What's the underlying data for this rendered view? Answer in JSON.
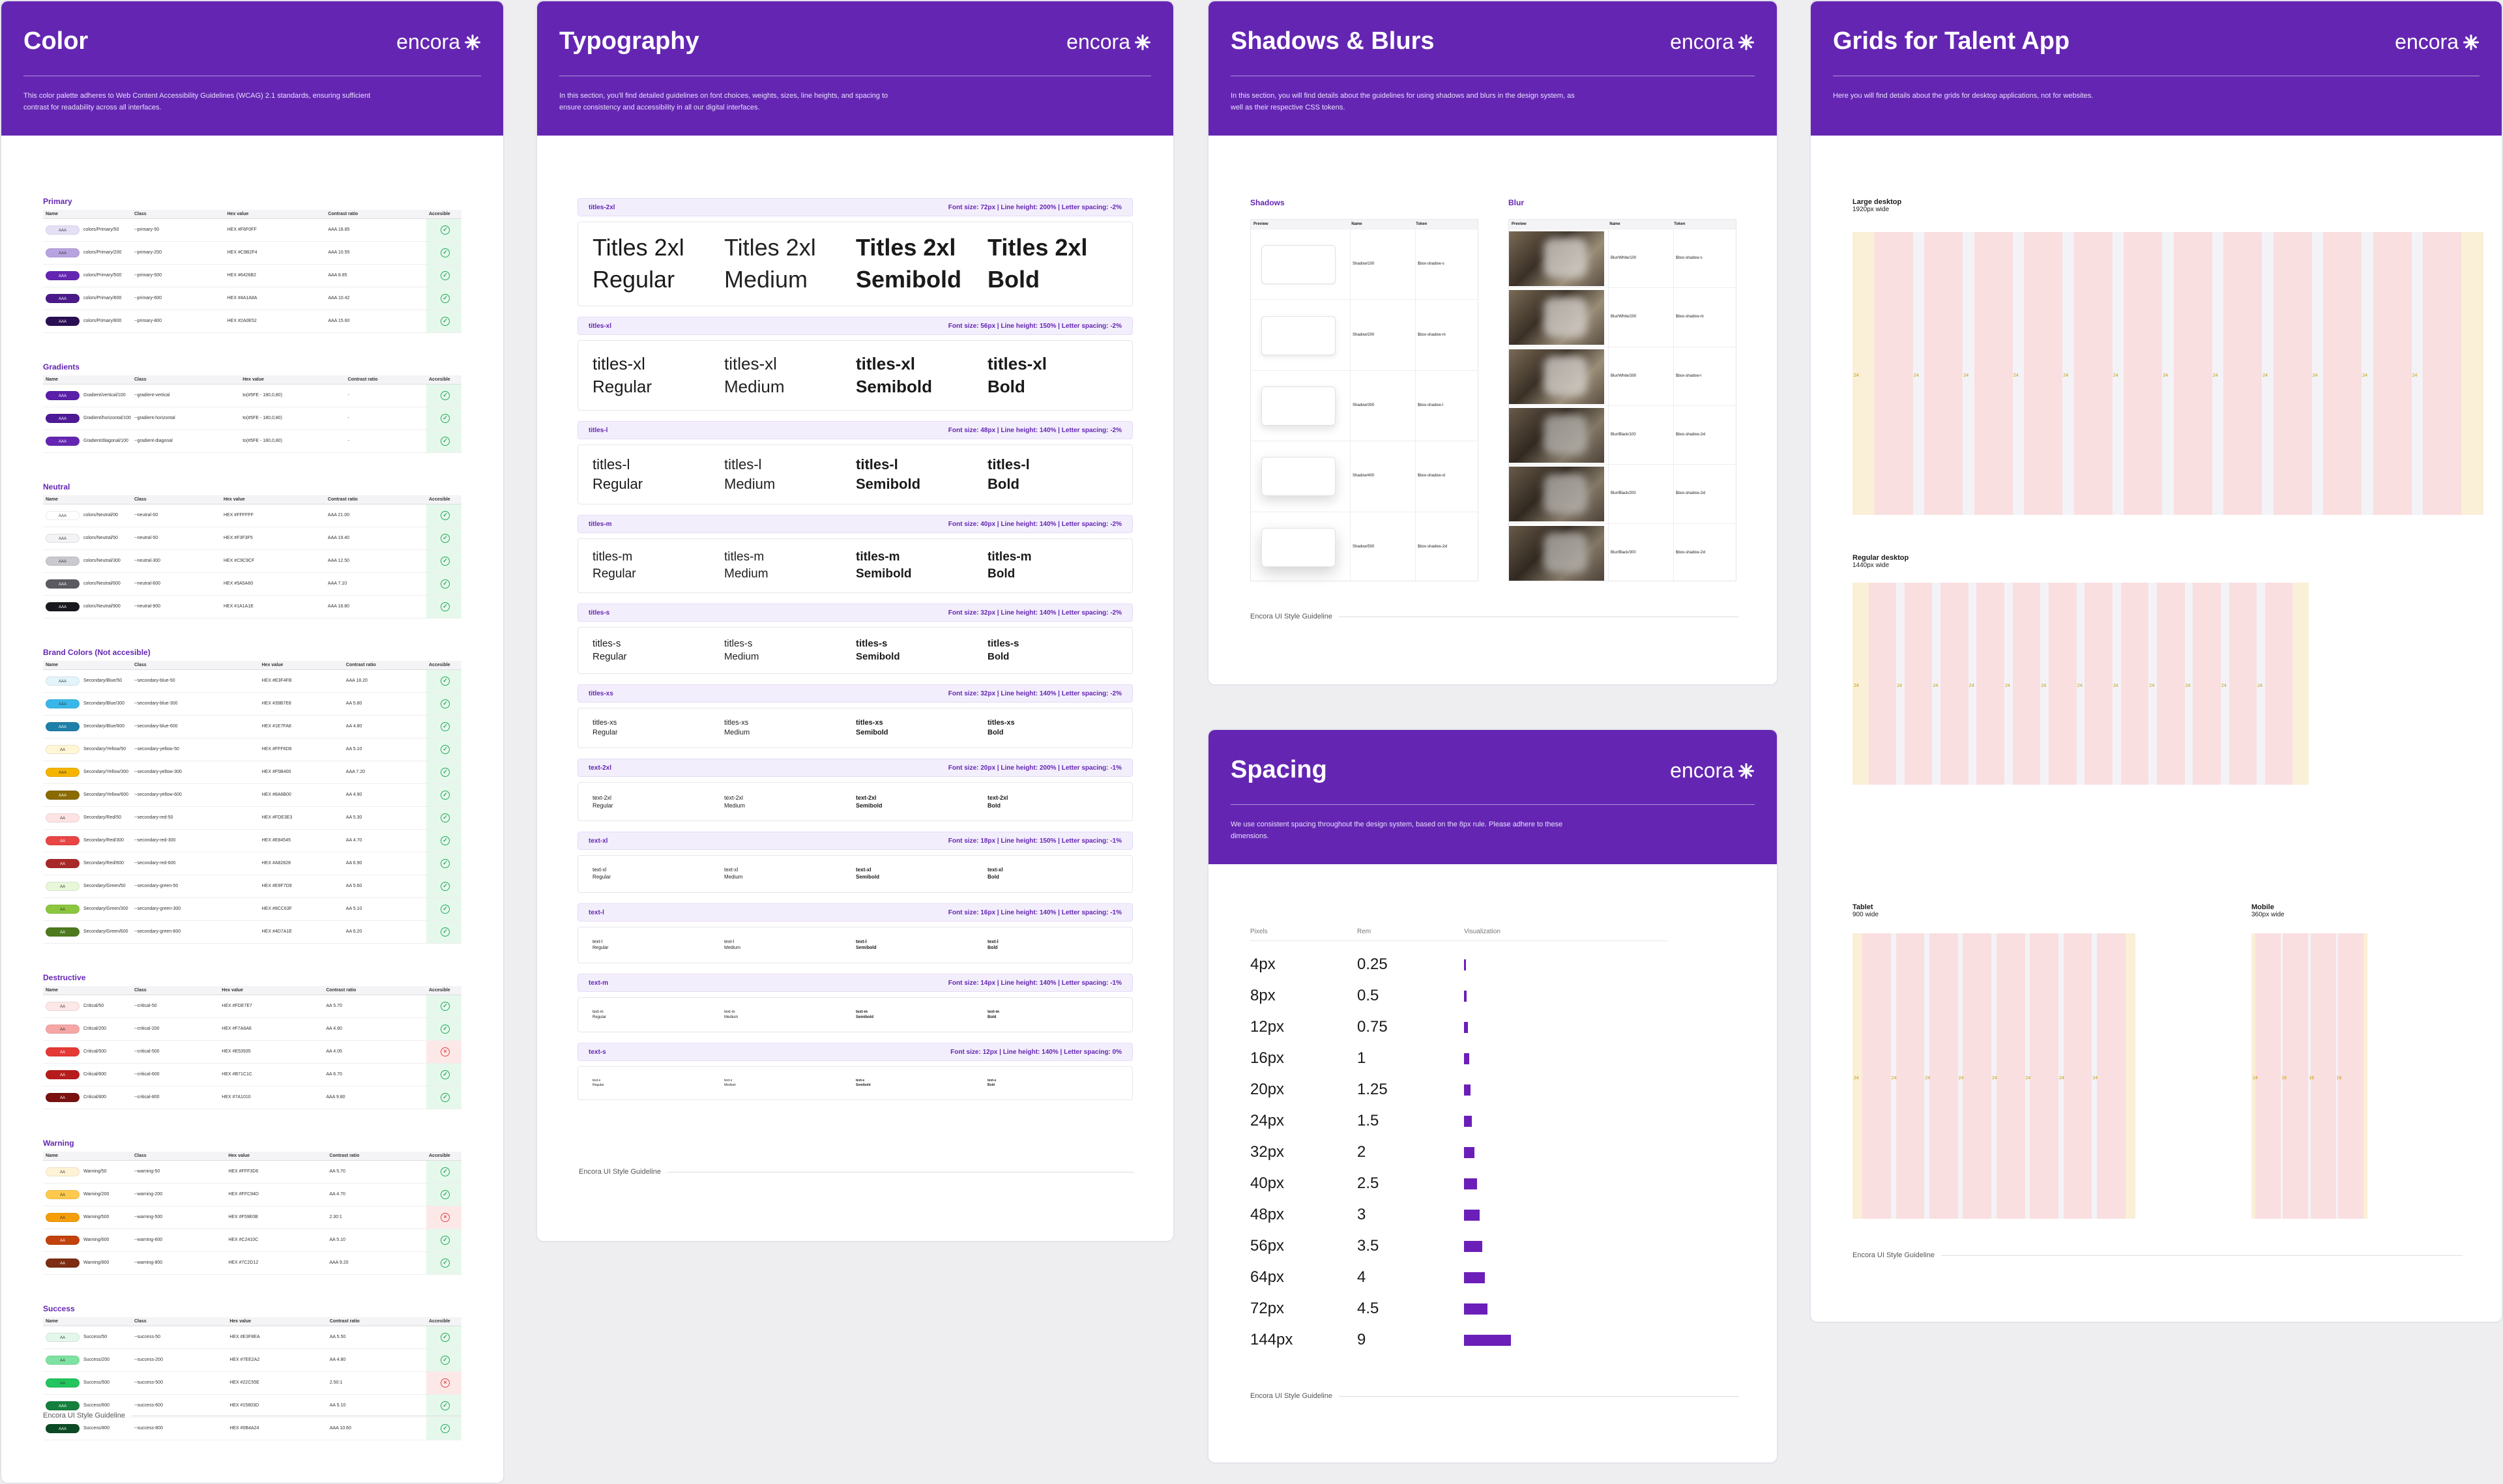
{
  "brand": "encora",
  "footer": "Encora UI Style Guideline",
  "color": {
    "title": "Color",
    "desc": "This color palette adheres to Web Content Accessibility Guidelines (WCAG) 2.1 standards, ensuring sufficient contrast for readability across all interfaces.",
    "headers": [
      "Name",
      "Class",
      "Hex value",
      "Contrast ratio",
      "Accesible"
    ],
    "groups": [
      {
        "name": "Primary",
        "rows": [
          {
            "swatch": "#e6e0f7",
            "label": "AAA",
            "name": "colors/Primary/50",
            "cls": "--primary-50",
            "hex": "HEX #F6F0FF",
            "ratio": "AAA 18.85",
            "ok": true
          },
          {
            "swatch": "#b8a3e0",
            "label": "AAA",
            "name": "colors/Primary/200",
            "cls": "--primary-200",
            "hex": "HEX #C9B2F4",
            "ratio": "AAA 10.55",
            "ok": true
          },
          {
            "swatch": "#6426b2",
            "label": "AAA",
            "name": "colors/Primary/500",
            "cls": "--primary-500",
            "hex": "HEX #6426B2",
            "ratio": "AAA 8.85",
            "ok": true
          },
          {
            "swatch": "#4a1a8a",
            "label": "AAA",
            "name": "colors/Primary/600",
            "cls": "--primary-600",
            "hex": "HEX #4A1A8A",
            "ratio": "AAA 10.42",
            "ok": true
          },
          {
            "swatch": "#2a0e52",
            "label": "AAA",
            "name": "colors/Primary/800",
            "cls": "--primary-800",
            "hex": "HEX #2A0E52",
            "ratio": "AAA 15.60",
            "ok": true
          }
        ]
      },
      {
        "name": "Gradients",
        "rows": [
          {
            "swatch": "#5a1fa8",
            "label": "AAA",
            "name": "Gradient/vertical/100",
            "cls": "--gradient-vertical",
            "hex": "to(#5FE - 180,0,80)",
            "ratio": "-",
            "ok": true
          },
          {
            "swatch": "#4f1a96",
            "label": "AAA",
            "name": "Gradient/horizontal/100",
            "cls": "--gradient-horizontal",
            "hex": "to(#5FE - 180,0,80)",
            "ratio": "-",
            "ok": true
          },
          {
            "swatch": "#6426b2",
            "label": "AAA",
            "name": "Gradient/diagonal/100",
            "cls": "--gradient-diagonal",
            "hex": "to(#5FE - 180,0,80)",
            "ratio": "-",
            "ok": true
          }
        ]
      },
      {
        "name": "Neutral",
        "rows": [
          {
            "swatch": "#ffffff",
            "label": "AAA",
            "name": "colors/Neutral/00",
            "cls": "--neutral-00",
            "hex": "HEX #FFFFFF",
            "ratio": "AAA 21.00",
            "ok": true
          },
          {
            "swatch": "#f3f3f5",
            "label": "AAA",
            "name": "colors/Neutral/50",
            "cls": "--neutral-50",
            "hex": "HEX #F3F3F5",
            "ratio": "AAA 19.40",
            "ok": true
          },
          {
            "swatch": "#c9c9cf",
            "label": "AAA",
            "name": "colors/Neutral/300",
            "cls": "--neutral-300",
            "hex": "HEX #C9C9CF",
            "ratio": "AAA 12.50",
            "ok": true
          },
          {
            "swatch": "#5a5a60",
            "label": "AAA",
            "name": "colors/Neutral/600",
            "cls": "--neutral-600",
            "hex": "HEX #5A5A60",
            "ratio": "AAA 7.10",
            "ok": true
          },
          {
            "swatch": "#1a1a1e",
            "label": "AAA",
            "name": "colors/Neutral/900",
            "cls": "--neutral-900",
            "hex": "HEX #1A1A1E",
            "ratio": "AAA 18.80",
            "ok": true
          }
        ]
      },
      {
        "name": "Brand Colors (Not accesible)",
        "rows": [
          {
            "swatch": "#e3f4fb",
            "label": "AAA",
            "name": "Secondary/Blue/50",
            "cls": "--secondary-blue-50",
            "hex": "HEX #E3F4FB",
            "ratio": "AAA 18.20",
            "ok": true
          },
          {
            "swatch": "#39b7e8",
            "label": "AAA",
            "name": "Secondary/Blue/300",
            "cls": "--secondary-blue-300",
            "hex": "HEX #39B7E8",
            "ratio": "AA 5.80",
            "ok": true
          },
          {
            "swatch": "#1e7fa8",
            "label": "AAA",
            "name": "Secondary/Blue/600",
            "cls": "--secondary-blue-600",
            "hex": "HEX #1E7FA8",
            "ratio": "AA 4.80",
            "ok": true
          },
          {
            "swatch": "#fff6d6",
            "label": "AA",
            "name": "Secondary/Yellow/50",
            "cls": "--secondary-yellow-50",
            "hex": "HEX #FFF6D6",
            "ratio": "AA 5.10",
            "ok": true
          },
          {
            "swatch": "#f5b400",
            "label": "AAA",
            "name": "Secondary/Yellow/300",
            "cls": "--secondary-yellow-300",
            "hex": "HEX #F5B400",
            "ratio": "AAA 7.20",
            "ok": true
          },
          {
            "swatch": "#8a6b00",
            "label": "AAA",
            "name": "Secondary/Yellow/600",
            "cls": "--secondary-yellow-600",
            "hex": "HEX #8A6B00",
            "ratio": "AA 4.90",
            "ok": true
          },
          {
            "swatch": "#fde3e3",
            "label": "AA",
            "name": "Secondary/Red/50",
            "cls": "--secondary-red-50",
            "hex": "HEX #FDE3E3",
            "ratio": "AA 5.30",
            "ok": true
          },
          {
            "swatch": "#e84545",
            "label": "AA",
            "name": "Secondary/Red/300",
            "cls": "--secondary-red-300",
            "hex": "HEX #E84545",
            "ratio": "AA 4.70",
            "ok": true
          },
          {
            "swatch": "#a82828",
            "label": "AA",
            "name": "Secondary/Red/600",
            "cls": "--secondary-red-600",
            "hex": "HEX #A82828",
            "ratio": "AA 6.90",
            "ok": true
          },
          {
            "swatch": "#e9f7d9",
            "label": "AA",
            "name": "Secondary/Green/50",
            "cls": "--secondary-green-50",
            "hex": "HEX #E9F7D9",
            "ratio": "AA 5.60",
            "ok": true
          },
          {
            "swatch": "#8cc63f",
            "label": "AA",
            "name": "Secondary/Green/300",
            "cls": "--secondary-green-300",
            "hex": "HEX #8CC63F",
            "ratio": "AA 5.10",
            "ok": true
          },
          {
            "swatch": "#4d7a1e",
            "label": "AA",
            "name": "Secondary/Green/600",
            "cls": "--secondary-green-600",
            "hex": "HEX #4D7A1E",
            "ratio": "AA 6.20",
            "ok": true
          }
        ]
      },
      {
        "name": "Destructive",
        "rows": [
          {
            "swatch": "#fde7e7",
            "label": "AA",
            "name": "Critical/50",
            "cls": "--critical-50",
            "hex": "HEX #FDE7E7",
            "ratio": "AA 5.70",
            "ok": true
          },
          {
            "swatch": "#f7a6a6",
            "label": "AA",
            "name": "Critical/200",
            "cls": "--critical-200",
            "hex": "HEX #F7A6A6",
            "ratio": "AA 4.60",
            "ok": true
          },
          {
            "swatch": "#e53935",
            "label": "AA",
            "name": "Critical/500",
            "cls": "--critical-500",
            "hex": "HEX #E53935",
            "ratio": "AA 4.05",
            "ok": false
          },
          {
            "swatch": "#b71c1c",
            "label": "AA",
            "name": "Critical/600",
            "cls": "--critical-600",
            "hex": "HEX #B71C1C",
            "ratio": "AA 6.70",
            "ok": true
          },
          {
            "swatch": "#7a1010",
            "label": "AA",
            "name": "Critical/800",
            "cls": "--critical-800",
            "hex": "HEX #7A1010",
            "ratio": "AAA 9.80",
            "ok": true
          }
        ]
      },
      {
        "name": "Warning",
        "rows": [
          {
            "swatch": "#fff3d6",
            "label": "AA",
            "name": "Warning/50",
            "cls": "--warning-50",
            "hex": "HEX #FFF3D6",
            "ratio": "AA 5.70",
            "ok": true
          },
          {
            "swatch": "#ffc94d",
            "label": "AA",
            "name": "Warning/200",
            "cls": "--warning-200",
            "hex": "HEX #FFC94D",
            "ratio": "AA 4.70",
            "ok": true
          },
          {
            "swatch": "#f59e0b",
            "label": "AA",
            "name": "Warning/500",
            "cls": "--warning-500",
            "hex": "HEX #F59E0B",
            "ratio": "2.30:1",
            "ok": false
          },
          {
            "swatch": "#c2410c",
            "label": "AA",
            "name": "Warning/600",
            "cls": "--warning-600",
            "hex": "HEX #C2410C",
            "ratio": "AA 5.10",
            "ok": true
          },
          {
            "swatch": "#7c2d12",
            "label": "AA",
            "name": "Warning/800",
            "cls": "--warning-800",
            "hex": "HEX #7C2D12",
            "ratio": "AAA 9.20",
            "ok": true
          }
        ]
      },
      {
        "name": "Success",
        "rows": [
          {
            "swatch": "#e3f8ea",
            "label": "AA",
            "name": "Success/50",
            "cls": "--success-50",
            "hex": "HEX #E3F8EA",
            "ratio": "AA 5.50",
            "ok": true
          },
          {
            "swatch": "#7ee2a2",
            "label": "AA",
            "name": "Success/200",
            "cls": "--success-200",
            "hex": "HEX #7EE2A2",
            "ratio": "AA 4.80",
            "ok": true
          },
          {
            "swatch": "#22c55e",
            "label": "AA",
            "name": "Success/500",
            "cls": "--success-500",
            "hex": "HEX #22C55E",
            "ratio": "2.50:1",
            "ok": false
          },
          {
            "swatch": "#15803d",
            "label": "AAA",
            "name": "Success/600",
            "cls": "--success-600",
            "hex": "HEX #15803D",
            "ratio": "AA 5.10",
            "ok": true
          },
          {
            "swatch": "#0b4a24",
            "label": "AAA",
            "name": "Success/800",
            "cls": "--success-800",
            "hex": "HEX #0B4A24",
            "ratio": "AAA 10.60",
            "ok": true
          }
        ]
      }
    ]
  },
  "typography": {
    "title": "Typography",
    "desc": "In this section, you'll find detailed guidelines on font choices, weights, sizes, line heights, and spacing to ensure consistency and accessibility in all our digital interfaces.",
    "styles": [
      {
        "name": "titles-2xl",
        "spec": "Font size: 72px | Line height: 200% | Letter spacing: -2%",
        "size": 36,
        "h": 130,
        "label": "Titles 2xl"
      },
      {
        "name": "titles-xl",
        "spec": "Font size: 56px | Line height: 150% | Letter spacing: -2%",
        "size": 26,
        "h": 108,
        "label": "titles-xl"
      },
      {
        "name": "titles-l",
        "spec": "Font size: 48px | Line height: 140% | Letter spacing: -2%",
        "size": 22,
        "h": 92,
        "label": "titles-l"
      },
      {
        "name": "titles-m",
        "spec": "Font size: 40px | Line height: 140% | Letter spacing: -2%",
        "size": 19,
        "h": 84,
        "label": "titles-m"
      },
      {
        "name": "titles-s",
        "spec": "Font size: 32px | Line height: 140% | Letter spacing: -2%",
        "size": 15,
        "h": 72,
        "label": "titles-s"
      },
      {
        "name": "titles-xs",
        "spec": "Font size: 32px | Line height: 140% | Letter spacing: -2%",
        "size": 11,
        "h": 62,
        "label": "titles-xs"
      },
      {
        "name": "text-2xl",
        "spec": "Font size: 20px | Line height: 200% | Letter spacing: -1%",
        "size": 9,
        "h": 60,
        "label": "text-2xl"
      },
      {
        "name": "text-xl",
        "spec": "Font size: 18px | Line height: 150% | Letter spacing: -1%",
        "size": 8,
        "h": 58,
        "label": "text-xl"
      },
      {
        "name": "text-l",
        "spec": "Font size: 16px | Line height: 140% | Letter spacing: -1%",
        "size": 7,
        "h": 56,
        "label": "text-l"
      },
      {
        "name": "text-m",
        "spec": "Font size: 14px | Line height: 140% | Letter spacing: -1%",
        "size": 6,
        "h": 54,
        "label": "text-m"
      },
      {
        "name": "text-s",
        "spec": "Font size: 12px | Line height: 140% | Letter spacing: 0%",
        "size": 5,
        "h": 52,
        "label": "text-s"
      }
    ],
    "weights": [
      "Regular",
      "Medium",
      "Semibold",
      "Bold"
    ]
  },
  "shadows": {
    "title": "Shadows & Blurs",
    "desc": "In this section, you will find details about the guidelines for using shadows and blurs in the design system, as well as their respective CSS tokens.",
    "shadows_label": "Shadows",
    "blur_label": "Blur",
    "headers": [
      "Preview",
      "Name",
      "Token"
    ],
    "shadow_rows": [
      {
        "name": "Shadow/100",
        "token": "$box-shadow-s"
      },
      {
        "name": "Shadow/200",
        "token": "$box-shadow-m"
      },
      {
        "name": "Shadow/300",
        "token": "$box-shadow-l"
      },
      {
        "name": "Shadow/400",
        "token": "$box-shadow-xl"
      },
      {
        "name": "Shadow/500",
        "token": "$box-shadow-2xl"
      }
    ],
    "blur_rows": [
      {
        "name": "Blur/White/100",
        "token": "$box-shadow-s"
      },
      {
        "name": "Blur/White/200",
        "token": "$box-shadow-m"
      },
      {
        "name": "Blur/White/300",
        "token": "$box-shadow-l"
      },
      {
        "name": "Blur/Black/100",
        "token": "$box-shadow-2xl"
      },
      {
        "name": "Blur/Black/200",
        "token": "$box-shadow-2xl"
      },
      {
        "name": "Blur/Black/300",
        "token": "$box-shadow-2xl"
      }
    ]
  },
  "spacing": {
    "title": "Spacing",
    "desc": "We use consistent spacing throughout the design system, based on the 8px rule. Please adhere to these dimensions.",
    "headers": [
      "Pixels",
      "Rem",
      "Visualization"
    ],
    "rows": [
      {
        "px": "4px",
        "rem": "0.25",
        "v": 4
      },
      {
        "px": "8px",
        "rem": "0.5",
        "v": 8
      },
      {
        "px": "12px",
        "rem": "0.75",
        "v": 12
      },
      {
        "px": "16px",
        "rem": "1",
        "v": 16
      },
      {
        "px": "20px",
        "rem": "1.25",
        "v": 20
      },
      {
        "px": "24px",
        "rem": "1.5",
        "v": 24
      },
      {
        "px": "32px",
        "rem": "2",
        "v": 32
      },
      {
        "px": "40px",
        "rem": "2.5",
        "v": 40
      },
      {
        "px": "48px",
        "rem": "3",
        "v": 48
      },
      {
        "px": "56px",
        "rem": "3.5",
        "v": 56
      },
      {
        "px": "64px",
        "rem": "4",
        "v": 64
      },
      {
        "px": "72px",
        "rem": "4.5",
        "v": 72
      },
      {
        "px": "144px",
        "rem": "9",
        "v": 144
      }
    ]
  },
  "grids": {
    "title": "Grids for Talent App",
    "desc": "Here you will find details about the grids for desktop applications, not for websites.",
    "items": [
      {
        "name": "Large desktop",
        "width": "1920px wide",
        "cols": 12,
        "margin": "24",
        "gutter": "24"
      },
      {
        "name": "Regular desktop",
        "width": "1440px wide",
        "cols": 12,
        "margin": "24",
        "gutter": "24"
      },
      {
        "name": "Tablet",
        "width": "900 wide",
        "cols": 8,
        "margin": "24",
        "gutter": "24"
      },
      {
        "name": "Mobile",
        "width": "360px wide",
        "cols": 4,
        "margin": "24",
        "gutter": "16"
      }
    ]
  }
}
